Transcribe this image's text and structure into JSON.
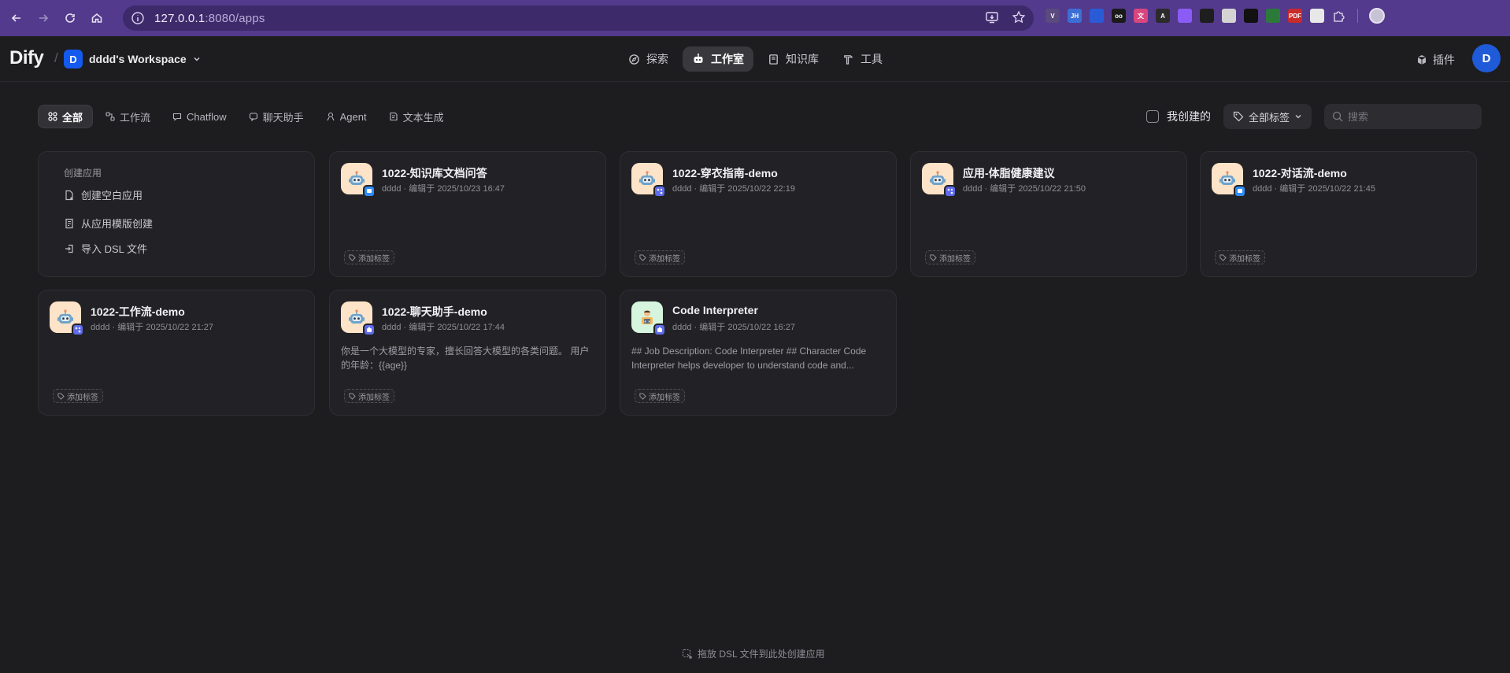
{
  "browser": {
    "url_host": "127.0.0.1",
    "url_rest": ":8080/apps",
    "extensions": [
      {
        "label": "V",
        "color": "#5a4a7e"
      },
      {
        "label": "JH",
        "color": "#3c6fd6"
      },
      {
        "label": "",
        "color": "#2a5bd7"
      },
      {
        "label": "oo",
        "color": "#1a1a1a"
      },
      {
        "label": "文",
        "color": "#d9467f"
      },
      {
        "label": "A",
        "color": "#2b2b2b"
      },
      {
        "label": "",
        "color": "#8a5cf5"
      },
      {
        "label": "",
        "color": "#1e1e1e"
      },
      {
        "label": "",
        "color": "#d4d4d4"
      },
      {
        "label": "",
        "color": "#111111"
      },
      {
        "label": "",
        "color": "#2c7a3a"
      },
      {
        "label": "PDF",
        "color": "#c92a2a"
      },
      {
        "label": "",
        "color": "#e8e8e8"
      }
    ]
  },
  "header": {
    "logo": "Dify",
    "workspace_initial": "D",
    "workspace_name": "dddd's Workspace",
    "nav": [
      {
        "label": "探索",
        "icon": "compass-icon",
        "active": false
      },
      {
        "label": "工作室",
        "icon": "robot-icon",
        "active": true
      },
      {
        "label": "知识库",
        "icon": "book-icon",
        "active": false
      },
      {
        "label": "工具",
        "icon": "hammer-icon",
        "active": false
      }
    ],
    "plugins_label": "插件",
    "user_initial": "D"
  },
  "tabs": [
    {
      "label": "全部",
      "icon": "grid-icon",
      "active": true
    },
    {
      "label": "工作流",
      "icon": "workflow-icon",
      "active": false
    },
    {
      "label": "Chatflow",
      "icon": "chatflow-icon",
      "active": false
    },
    {
      "label": "聊天助手",
      "icon": "chat-icon",
      "active": false
    },
    {
      "label": "Agent",
      "icon": "agent-icon",
      "active": false
    },
    {
      "label": "文本生成",
      "icon": "text-gen-icon",
      "active": false
    }
  ],
  "filters": {
    "mine_label": "我创建的",
    "tags_label": "全部标签",
    "search_placeholder": "搜索"
  },
  "create_card": {
    "title": "创建应用",
    "items": [
      {
        "label": "创建空白应用",
        "icon": "file-plus-icon"
      },
      {
        "label": "从应用模版创建",
        "icon": "template-icon"
      },
      {
        "label": "导入 DSL 文件",
        "icon": "import-icon"
      }
    ]
  },
  "apps": [
    {
      "name": "1022-知识库文档问答",
      "author": "dddd",
      "edited": "编辑于 2025/10/23 16:47",
      "desc": "",
      "icon_bg": "orange",
      "badge": "chat"
    },
    {
      "name": "1022-穿衣指南-demo",
      "author": "dddd",
      "edited": "编辑于 2025/10/22 22:19",
      "desc": "",
      "icon_bg": "orange",
      "badge": "workflow"
    },
    {
      "name": "应用-体脂健康建议",
      "author": "dddd",
      "edited": "编辑于 2025/10/22 21:50",
      "desc": "",
      "icon_bg": "orange",
      "badge": "workflow"
    },
    {
      "name": "1022-对话流-demo",
      "author": "dddd",
      "edited": "编辑于 2025/10/22 21:45",
      "desc": "",
      "icon_bg": "orange",
      "badge": "chat"
    },
    {
      "name": "1022-工作流-demo",
      "author": "dddd",
      "edited": "编辑于 2025/10/22 21:27",
      "desc": "",
      "icon_bg": "orange",
      "badge": "workflow"
    },
    {
      "name": "1022-聊天助手-demo",
      "author": "dddd",
      "edited": "编辑于 2025/10/22 17:44",
      "desc": "你是一个大模型的专家，擅长回答大模型的各类问题。 用户的年龄：{{age}}",
      "icon_bg": "orange",
      "badge": "assistant"
    },
    {
      "name": "Code Interpreter",
      "author": "dddd",
      "edited": "编辑于 2025/10/22 16:27",
      "desc": "## Job Description: Code Interpreter ## Character Code Interpreter helps developer to understand code and...",
      "icon_bg": "green",
      "badge": "assistant"
    }
  ],
  "add_tag_label": "添加标签",
  "meta_separator": "·",
  "footer_hint": "拖放 DSL 文件到此处创建应用"
}
